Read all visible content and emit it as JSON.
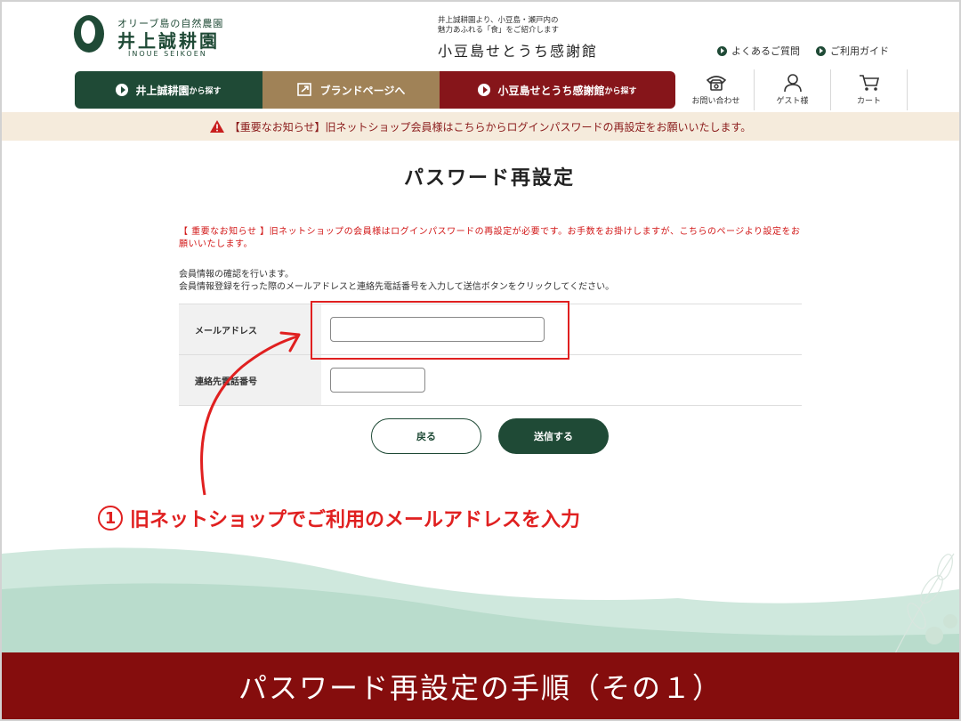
{
  "header": {
    "logo_small": "オリーブ島の自然農園",
    "logo_name": "井上誠耕園",
    "logo_roman": "INOUE SEIKOEN",
    "promo_line1": "井上誠耕園より、小豆島・瀬戸内の",
    "promo_line2": "魅力あふれる「食」をご紹介します",
    "promo_title": "小豆島せとうち感謝館",
    "links": [
      "よくあるご質問",
      "ご利用ガイド"
    ]
  },
  "nav": {
    "btn1_main": "井上誠耕園",
    "btn1_small": "から探す",
    "btn2": "ブランドページへ",
    "btn3_main": "小豆島せとうち感謝館",
    "btn3_small": "から探す",
    "contact": "お問い合わせ",
    "guest": "ゲスト様",
    "cart": "カート"
  },
  "notice": "【重要なお知らせ】旧ネットショップ会員様はこちらからログインパスワードの再設定をお願いいたします。",
  "page": {
    "title": "パスワード再設定",
    "red_notice": "【 重要なお知らせ 】旧ネットショップの会員様はログインパスワードの再設定が必要です。お手数をお掛けしますが、こちらのページより設定をお願いいたします。",
    "info_line1": "会員情報の確認を行います。",
    "info_line2": "会員情報登録を行った際のメールアドレスと連絡先電話番号を入力して送信ボタンをクリックしてください。",
    "email_label": "メールアドレス",
    "email_value": "",
    "tel_label": "連絡先電話番号",
    "tel_value": "",
    "back_button": "戻る",
    "send_button": "送信する"
  },
  "annotation": {
    "number": "1",
    "text": "旧ネットショップでご利用のメールアドレスを入力"
  },
  "footer_title": "パスワード再設定の手順（その１）",
  "colors": {
    "green": "#1f4a36",
    "gold": "#a08257",
    "maroon": "#86151a",
    "annotation_red": "#e02020",
    "banner": "#850d0d"
  }
}
